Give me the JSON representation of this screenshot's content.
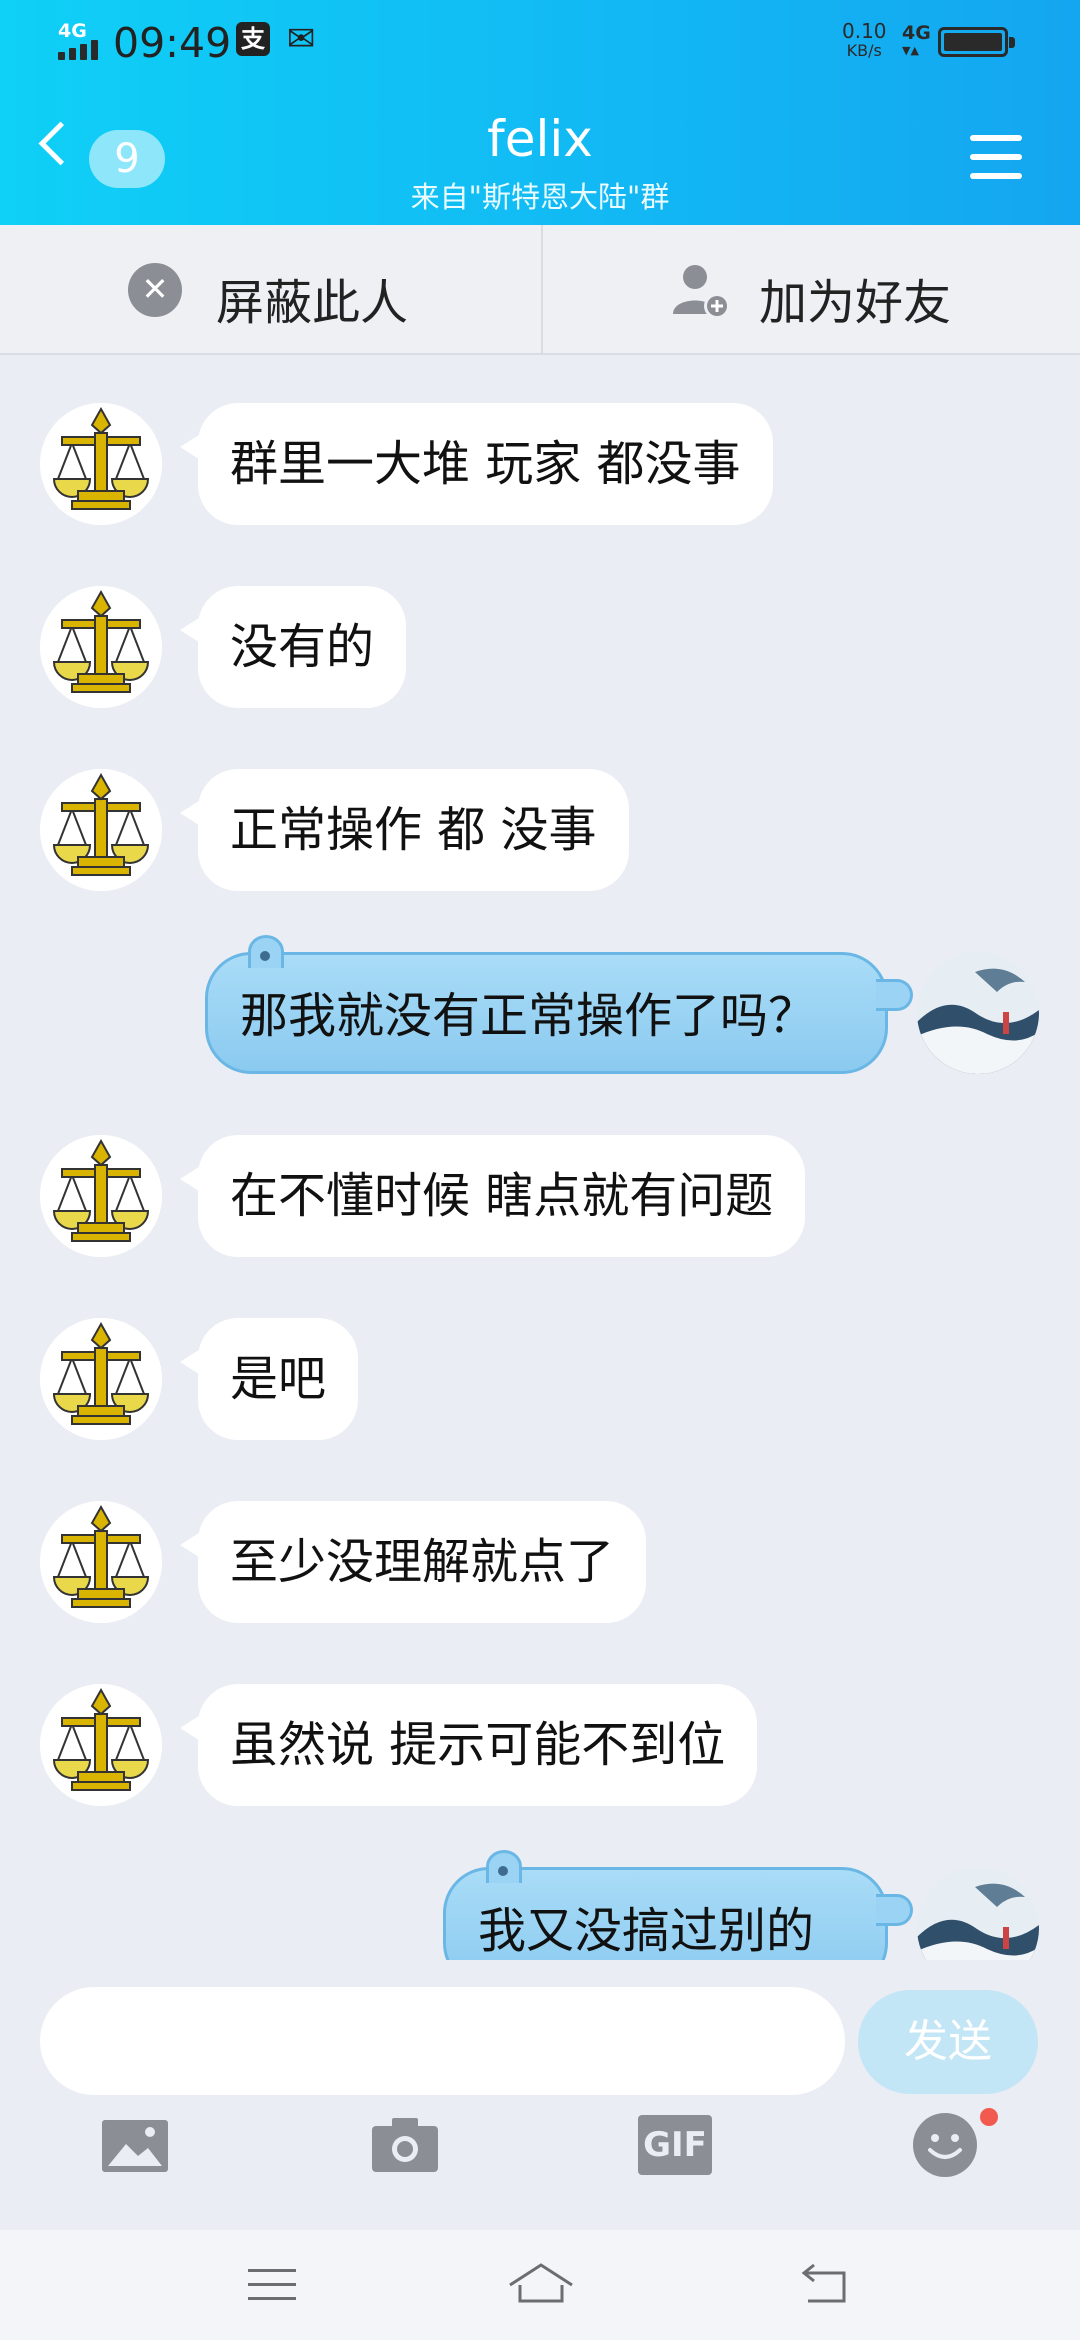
{
  "status_bar": {
    "network": "4G",
    "time": "09:49",
    "speed_value": "0.10",
    "speed_unit": "KB/s",
    "network_right": "4G"
  },
  "header": {
    "back_count": "9",
    "title": "felix",
    "subtitle": "来自\"斯特恩大陆\"群"
  },
  "actions": {
    "block_label": "屏蔽此人",
    "add_friend_label": "加为好友"
  },
  "messages": [
    {
      "side": "left",
      "text": "群里一大堆 玩家 都没事"
    },
    {
      "side": "left",
      "text": "没有的"
    },
    {
      "side": "left",
      "text": "正常操作 都 没事"
    },
    {
      "side": "right",
      "text": "那我就没有正常操作了吗？"
    },
    {
      "side": "left",
      "text": "在不懂时候 瞎点就有问题"
    },
    {
      "side": "left",
      "text": "是吧"
    },
    {
      "side": "left",
      "text": "至少没理解就点了"
    },
    {
      "side": "left",
      "text": "虽然说 提示可能不到位"
    },
    {
      "side": "right",
      "text": "我又没搞过别的"
    }
  ],
  "composer": {
    "input_value": "",
    "send_label": "发送"
  },
  "toolbar": {
    "gif_label": "GIF"
  },
  "colors": {
    "header_start": "#0fd0f6",
    "header_end": "#14a6f0",
    "chat_bg": "#eaedf3",
    "self_bubble": "#9bd3f4",
    "send_button": "#c3e6f6",
    "notification_dot": "#f35a4f"
  }
}
